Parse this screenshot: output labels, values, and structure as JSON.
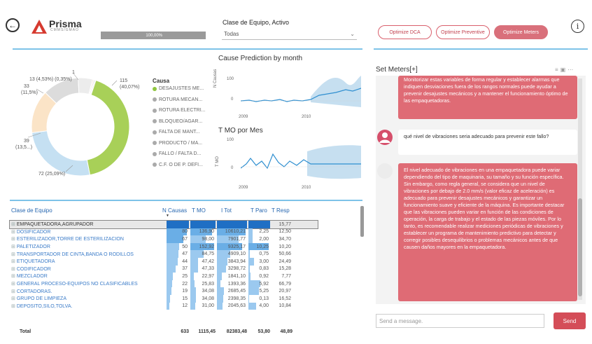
{
  "header": {
    "logo_text": "Prisma",
    "logo_sub": "CMMS/GMAO",
    "progress_text": "100,00%",
    "progress_fraction": 1.0,
    "filter_label": "Clase de Equipo, Activo",
    "filter_value": "Todas",
    "buttons": [
      "Optimize DCA",
      "Optimize Preventive",
      "Optimize Meters"
    ]
  },
  "donut": {
    "labels": {
      "top1": "1",
      "top2": "13 (4,53%) (0,35%)",
      "left1": "33",
      "left2": "(11,5%)",
      "left3": "39",
      "left4": "(13,5...)",
      "right1": "115",
      "right2": "(40,07%)",
      "bottom": "72 (25,09%)"
    },
    "slices": [
      {
        "name": "DESAJUSTES ME...",
        "value": 115,
        "color": "#a8d058"
      },
      {
        "name": "ROTURA MECAN...",
        "value": 72,
        "color": "#c5e0f2"
      },
      {
        "name": "ROTURA ELECTRI...",
        "value": 39,
        "color": "#fbe4c7"
      },
      {
        "name": "BLOQUEO/AGAR...",
        "value": 33,
        "color": "#dcdcdc"
      },
      {
        "name": "FALTA DE MANT...",
        "value": 13,
        "color": "#ececec"
      },
      {
        "name": "PRODUCTO / MA...",
        "value": 1,
        "color": "#f3d2d2"
      },
      {
        "name": "FALLO / FALTA D...",
        "value": 1,
        "color": "#d9d9d9"
      },
      {
        "name": "C.F. O DE P. DEFI...",
        "value": 1,
        "color": "#e5e5e5"
      }
    ]
  },
  "legend": {
    "title": "Causa",
    "items": [
      "DESAJUSTES ME...",
      "ROTURA MECAN...",
      "ROTURA ELECTRI...",
      "BLOQUEO/AGAR...",
      "FALTA DE MANT...",
      "PRODUCTO / MA...",
      "FALLO / FALTA D...",
      "C.F. O DE P. DEFI..."
    ]
  },
  "charts": {
    "cause_title": "Cause Prediction by month",
    "cause_ylabel": "N Causas",
    "cause_ticks": [
      "100",
      "0"
    ],
    "tmo_title": "T MO por Mes",
    "tmo_ylabel": "T MO",
    "tmo_ticks": [
      "100",
      "0"
    ],
    "x_ticks": [
      "2009",
      "2010"
    ]
  },
  "table": {
    "headers": [
      "Clase de Equipo",
      "N Causas",
      "T MO",
      "I Tot",
      "T Paro",
      "T Resp"
    ],
    "rows": [
      {
        "name": "EMPAQUETADORA,AGRUPADOR",
        "n": "",
        "tmo": "",
        "itot": "",
        "tparo": "",
        "tresp": "15,77"
      },
      {
        "name": "DOSIFICADOR",
        "n": "80",
        "tmo": "136,90",
        "itot": "10610,21",
        "tparo": "2,25",
        "tresp": "12,50"
      },
      {
        "name": "ESTERILIZADOR,TORRE DE ESTERILIZACION",
        "n": "67",
        "tmo": "98,00",
        "itot": "7901,77",
        "tparo": "2,00",
        "tresp": "34,70"
      },
      {
        "name": "PALETIZADOR",
        "n": "50",
        "tmo": "152,92",
        "itot": "9325,17",
        "tparo": "10,25",
        "tresp": "10,20"
      },
      {
        "name": "TRANSPORTADOR DE CINTA,BANDA O RODILLOS",
        "n": "47",
        "tmo": "84,75",
        "itot": "4909,10",
        "tparo": "0,75",
        "tresp": "50,66"
      },
      {
        "name": "ETIQUETADORA",
        "n": "44",
        "tmo": "47,42",
        "itot": "3843,94",
        "tparo": "3,00",
        "tresp": "24,49"
      },
      {
        "name": "CODIFICADOR",
        "n": "37",
        "tmo": "47,33",
        "itot": "3298,72",
        "tparo": "0,83",
        "tresp": "15,28"
      },
      {
        "name": "MEZCLADOR",
        "n": "25",
        "tmo": "22,97",
        "itot": "1841,10",
        "tparo": "0,92",
        "tresp": "7,77"
      },
      {
        "name": "GENERAL PROCESO-EQUIPOS NO CLASIFICABLES",
        "n": "22",
        "tmo": "25,83",
        "itot": "1393,36",
        "tparo": "5,92",
        "tresp": "66,79"
      },
      {
        "name": "CORTADORAS.",
        "n": "19",
        "tmo": "34,08",
        "itot": "2685,45",
        "tparo": "5,25",
        "tresp": "20,97"
      },
      {
        "name": "GRUPO DE LIMPIEZA",
        "n": "15",
        "tmo": "34,08",
        "itot": "2398,35",
        "tparo": "0,13",
        "tresp": "16,52"
      },
      {
        "name": "DEPOSITO,SILO,TOLVA.",
        "n": "12",
        "tmo": "31,00",
        "itot": "2045,63",
        "tparo": "4,00",
        "tresp": "10,84"
      }
    ],
    "total": {
      "label": "Total",
      "n": "633",
      "tmo": "1115,45",
      "itot": "82383,48",
      "tparo": "53,80",
      "tresp": "48,89"
    }
  },
  "chat": {
    "title": "Set Meters[+]",
    "msg1": "Monitorizar estas variables de forma regular y establecer alarmas que indiquen desviaciones fuera de los rangos normales puede ayudar a prevenir desajustes mecánicos y a mantener el funcionamiento óptimo de las empaquetadoras.",
    "msg2": "qué nivel de vibraciones seria adecuado para prevenir este fallo?",
    "msg3": "El nivel adecuado de vibraciones en una empaquetadora puede variar dependiendo del tipo de maquinaria, su tamaño y su función específica. Sin embargo, como regla general, se considera que un nivel de vibraciones por debajo de 2.0 mm/s (valor eficaz de aceleración) es adecuado para prevenir desajustes mecánicos y garantizar un funcionamiento suave y eficiente de la máquina. Es importante destacar que las vibraciones pueden variar en función de las condiciones de operación, la carga de trabajo y el estado de las piezas móviles. Por lo tanto, es recomendable realizar mediciones periódicas de vibraciones y establecer un programa de mantenimiento predictivo para detectar y corregir posibles desequilibrios o problemas mecánicos antes de que causen daños mayores en la empaquetadora.",
    "placeholder": "Send a message.",
    "send_label": "Send"
  }
}
